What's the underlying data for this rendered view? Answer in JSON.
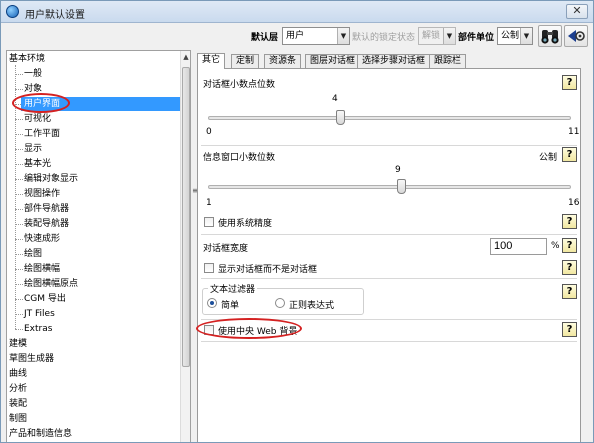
{
  "window": {
    "title": "用户默认设置",
    "close_label": "✕"
  },
  "toolbar": {
    "layer_label": "默认层",
    "layer_value": "用户",
    "lock_state_label": "默认的锁定状态",
    "lock_state_value": "解锁",
    "part_units_label": "部件单位",
    "part_units_value": "公制"
  },
  "tree": {
    "items": [
      "基本环境",
      "一般",
      "对象",
      "用户界面",
      "可视化",
      "工作平面",
      "显示",
      "基本光",
      "编辑对象显示",
      "视图操作",
      "部件导航器",
      "装配导航器",
      "快速成形",
      "绘图",
      "绘图横幅",
      "绘图横幅原点",
      "CGM 导出",
      "JT Files",
      "Extras",
      "建模",
      "草图生成器",
      "曲线",
      "分析",
      "装配",
      "制图",
      "产品和制造信息"
    ],
    "selected": "用户界面"
  },
  "tabs": [
    "其它",
    "定制",
    "资源条",
    "图层对话框",
    "选择步骤对话框",
    "跟踪栏"
  ],
  "settings": {
    "dialog_decimals": {
      "label": "对话框小数点位数",
      "value": 4,
      "min": 0,
      "max": 11,
      "min_label": "0",
      "max_label": "11",
      "value_label": "4"
    },
    "info_decimals": {
      "label": "信息窗口小数位数",
      "unit": "公制",
      "value": 9,
      "min": 1,
      "max": 16,
      "min_label": "1",
      "max_label": "16",
      "value_label": "9"
    },
    "use_system_precision": {
      "label": "使用系统精度",
      "checked": false
    },
    "dialog_width": {
      "label": "对话框宽度",
      "value": "100",
      "unit": "%"
    },
    "show_dialog_not_only": {
      "label": "显示对话框而不是对话框",
      "checked": false
    },
    "text_filter": {
      "title": "文本过滤器",
      "options": [
        "简单",
        "正则表达式"
      ],
      "selected": "简单"
    },
    "use_center_web_bg": {
      "label": "使用中央 Web 背景",
      "checked": false
    }
  },
  "help_label": "?",
  "colors": {
    "selection": "#3399ff",
    "annotation": "#d42121"
  }
}
